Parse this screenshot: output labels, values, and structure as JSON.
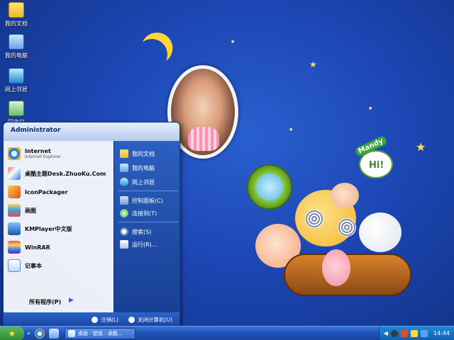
{
  "desktop": {
    "icons": [
      {
        "label": "我的文档",
        "icon": "folder-icon"
      },
      {
        "label": "我的电脑",
        "icon": "computer-icon"
      },
      {
        "label": "网上邻居",
        "icon": "network-icon"
      },
      {
        "label": "回收站",
        "icon": "recycle-bin-icon"
      }
    ],
    "wallpaper": {
      "bubble_text": "Hi!",
      "sign_text": "Mandy"
    }
  },
  "start_menu": {
    "user": "Administrator",
    "programs": [
      {
        "name": "Internet",
        "sub": "Internet Explorer",
        "icon": "internet-explorer-icon"
      },
      {
        "name": "桌酷主题Desk.ZhuoKu.Com",
        "sub": "",
        "icon": "theme-icon"
      },
      {
        "name": "IconPackager",
        "sub": "",
        "icon": "iconpackager-icon"
      },
      {
        "name": "画图",
        "sub": "",
        "icon": "paint-icon"
      },
      {
        "name": "KMPlayer中文版",
        "sub": "",
        "icon": "kmplayer-icon"
      },
      {
        "name": "WinRAR",
        "sub": "",
        "icon": "winrar-icon"
      },
      {
        "name": "记事本",
        "sub": "",
        "icon": "notepad-icon"
      }
    ],
    "all_programs": "所有程序(P)",
    "places": [
      {
        "label": "我的文档",
        "icon": "documents-icon"
      },
      {
        "label": "我的电脑",
        "icon": "computer-icon"
      },
      {
        "label": "网上邻居",
        "icon": "network-icon"
      },
      {
        "label": "控制面板(C)",
        "icon": "control-panel-icon"
      },
      {
        "label": "连接到(T)",
        "icon": "connect-icon"
      },
      {
        "label": "搜索(S)",
        "icon": "search-icon"
      },
      {
        "label": "运行(R)...",
        "icon": "run-icon"
      }
    ],
    "logoff": "注销(L)",
    "shutdown": "关闭计算机(U)"
  },
  "taskbar": {
    "task_label": "桌面 - 壁纸 - 桌酷...",
    "clock": "14:44"
  }
}
